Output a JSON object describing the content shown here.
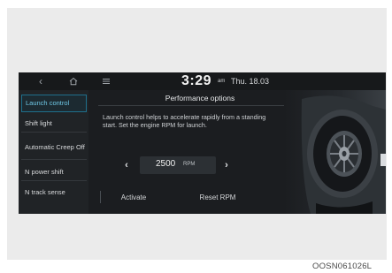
{
  "topbar": {
    "back_icon": "back-arrow-icon",
    "home_icon": "home-icon",
    "menu_icon": "menu-icon",
    "time": "3:29",
    "ampm": "am",
    "date": "Thu. 18.03"
  },
  "sidebar": {
    "items": [
      {
        "label": "Launch control",
        "active": true
      },
      {
        "label": "Shift light"
      },
      {
        "label": "Automatic Creep Off"
      },
      {
        "label": "N power shift"
      },
      {
        "label": "N track sense"
      }
    ]
  },
  "main": {
    "title": "Performance options",
    "description": "Launch control helps to accelerate rapidly from a standing start. Set the engine RPM for launch.",
    "rpm": {
      "value": "2500",
      "unit": "RPM"
    },
    "buttons": {
      "activate": "Activate",
      "reset": "Reset RPM"
    }
  },
  "caption": "OOSN061026L",
  "colors": {
    "accent": "#6fc8e6",
    "screen_bg": "#1b1d20"
  }
}
